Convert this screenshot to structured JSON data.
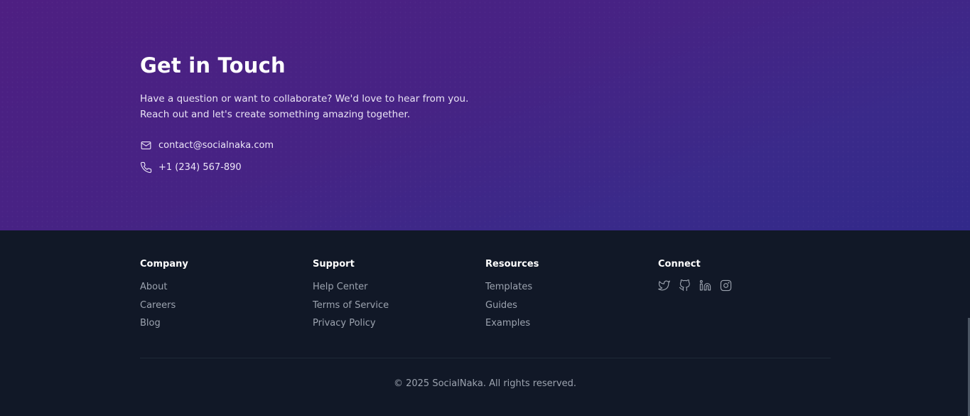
{
  "contact": {
    "title": "Get in Touch",
    "description": "Have a question or want to collaborate? We'd love to hear from you. Reach out and let's create something amazing together.",
    "email": "contact@socialnaka.com",
    "phone": "+1 (234) 567-890"
  },
  "footer": {
    "columns": [
      {
        "heading": "Company",
        "links": [
          "About",
          "Careers",
          "Blog"
        ]
      },
      {
        "heading": "Support",
        "links": [
          "Help Center",
          "Terms of Service",
          "Privacy Policy"
        ]
      },
      {
        "heading": "Resources",
        "links": [
          "Templates",
          "Guides",
          "Examples"
        ]
      },
      {
        "heading": "Connect",
        "icons": [
          "twitter-icon",
          "github-icon",
          "linkedin-icon",
          "instagram-icon"
        ]
      }
    ],
    "copyright": "© 2025 SocialNaka. All rights reserved."
  },
  "colors": {
    "footer_bg": "#111827",
    "contact_gradient_start": "#4e1f82",
    "contact_gradient_end": "#32298a",
    "muted_text": "#9ca3af"
  }
}
